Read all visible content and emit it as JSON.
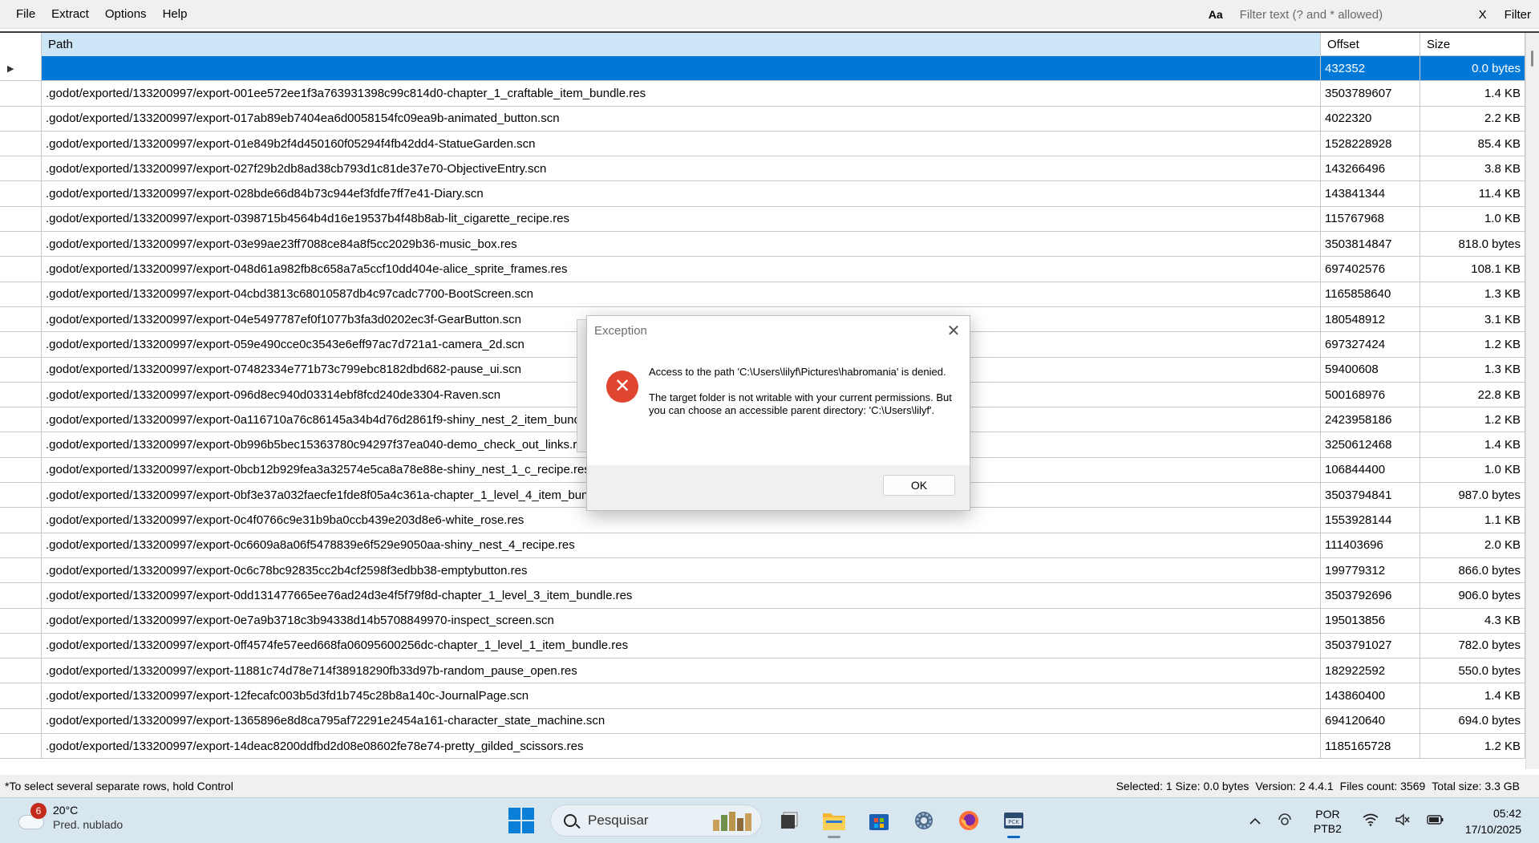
{
  "menu": {
    "items": [
      "File",
      "Extract",
      "Options",
      "Help"
    ],
    "case_toggle": "Aa",
    "filter_placeholder": "Filter text (? and * allowed)",
    "clear_label": "X",
    "filter_button": "Filter"
  },
  "grid": {
    "headers": {
      "path": "Path",
      "offset": "Offset",
      "size": "Size"
    },
    "rows": [
      {
        "path": "",
        "offset": "432352",
        "size": "0.0 bytes",
        "selected": true
      },
      {
        "path": ".godot/exported/133200997/export-001ee572ee1f3a763931398c99c814d0-chapter_1_craftable_item_bundle.res",
        "offset": "3503789607",
        "size": "1.4 KB"
      },
      {
        "path": ".godot/exported/133200997/export-017ab89eb7404ea6d0058154fc09ea9b-animated_button.scn",
        "offset": "4022320",
        "size": "2.2 KB"
      },
      {
        "path": ".godot/exported/133200997/export-01e849b2f4d450160f05294f4fb42dd4-StatueGarden.scn",
        "offset": "1528228928",
        "size": "85.4 KB"
      },
      {
        "path": ".godot/exported/133200997/export-027f29b2db8ad38cb793d1c81de37e70-ObjectiveEntry.scn",
        "offset": "143266496",
        "size": "3.8 KB"
      },
      {
        "path": ".godot/exported/133200997/export-028bde66d84b73c944ef3fdfe7ff7e41-Diary.scn",
        "offset": "143841344",
        "size": "11.4 KB"
      },
      {
        "path": ".godot/exported/133200997/export-0398715b4564b4d16e19537b4f48b8ab-lit_cigarette_recipe.res",
        "offset": "115767968",
        "size": "1.0 KB"
      },
      {
        "path": ".godot/exported/133200997/export-03e99ae23ff7088ce84a8f5cc2029b36-music_box.res",
        "offset": "3503814847",
        "size": "818.0 bytes"
      },
      {
        "path": ".godot/exported/133200997/export-048d61a982fb8c658a7a5ccf10dd404e-alice_sprite_frames.res",
        "offset": "697402576",
        "size": "108.1 KB"
      },
      {
        "path": ".godot/exported/133200997/export-04cbd3813c68010587db4c97cadc7700-BootScreen.scn",
        "offset": "1165858640",
        "size": "1.3 KB"
      },
      {
        "path": ".godot/exported/133200997/export-04e5497787ef0f1077b3fa3d0202ec3f-GearButton.scn",
        "offset": "180548912",
        "size": "3.1 KB"
      },
      {
        "path": ".godot/exported/133200997/export-059e490cce0c3543e6eff97ac7d721a1-camera_2d.scn",
        "offset": "697327424",
        "size": "1.2 KB"
      },
      {
        "path": ".godot/exported/133200997/export-07482334e771b73c799ebc8182dbd682-pause_ui.scn",
        "offset": "59400608",
        "size": "1.3 KB"
      },
      {
        "path": ".godot/exported/133200997/export-096d8ec940d03314ebf8fcd240de3304-Raven.scn",
        "offset": "500168976",
        "size": "22.8 KB"
      },
      {
        "path": ".godot/exported/133200997/export-0a116710a76c86145a34b4d76d2861f9-shiny_nest_2_item_bundle.r",
        "offset": "2423958186",
        "size": "1.2 KB"
      },
      {
        "path": ".godot/exported/133200997/export-0b996b5bec15363780c94297f37ea040-demo_check_out_links.res",
        "offset": "3250612468",
        "size": "1.4 KB"
      },
      {
        "path": ".godot/exported/133200997/export-0bcb12b929fea3a32574e5ca8a78e88e-shiny_nest_1_c_recipe.res",
        "offset": "106844400",
        "size": "1.0 KB"
      },
      {
        "path": ".godot/exported/133200997/export-0bf3e37a032faecfe1fde8f05a4c361a-chapter_1_level_4_item_bundle",
        "offset": "3503794841",
        "size": "987.0 bytes"
      },
      {
        "path": ".godot/exported/133200997/export-0c4f0766c9e31b9ba0ccb439e203d8e6-white_rose.res",
        "offset": "1553928144",
        "size": "1.1 KB"
      },
      {
        "path": ".godot/exported/133200997/export-0c6609a8a06f5478839e6f529e9050aa-shiny_nest_4_recipe.res",
        "offset": "111403696",
        "size": "2.0 KB"
      },
      {
        "path": ".godot/exported/133200997/export-0c6c78bc92835cc2b4cf2598f3edbb38-emptybutton.res",
        "offset": "199779312",
        "size": "866.0 bytes"
      },
      {
        "path": ".godot/exported/133200997/export-0dd131477665ee76ad24d3e4f5f79f8d-chapter_1_level_3_item_bundle.res",
        "offset": "3503792696",
        "size": "906.0 bytes"
      },
      {
        "path": ".godot/exported/133200997/export-0e7a9b3718c3b94338d14b5708849970-inspect_screen.scn",
        "offset": "195013856",
        "size": "4.3 KB"
      },
      {
        "path": ".godot/exported/133200997/export-0ff4574fe57eed668fa06095600256dc-chapter_1_level_1_item_bundle.res",
        "offset": "3503791027",
        "size": "782.0 bytes"
      },
      {
        "path": ".godot/exported/133200997/export-11881c74d78e714f38918290fb33d97b-random_pause_open.res",
        "offset": "182922592",
        "size": "550.0 bytes"
      },
      {
        "path": ".godot/exported/133200997/export-12fecafc003b5d3fd1b745c28b8a140c-JournalPage.scn",
        "offset": "143860400",
        "size": "1.4 KB"
      },
      {
        "path": ".godot/exported/133200997/export-1365896e8d8ca795af72291e2454a161-character_state_machine.scn",
        "offset": "694120640",
        "size": "694.0 bytes"
      },
      {
        "path": ".godot/exported/133200997/export-14deac8200ddfbd2d08e08602fe78e74-pretty_gilded_scissors.res",
        "offset": "1185165728",
        "size": "1.2 KB"
      }
    ]
  },
  "status": {
    "hint": "*To select several separate rows, hold Control",
    "selected": "Selected: 1 Size: 0.0 bytes",
    "version": "Version: 2 4.4.1",
    "files": "Files count: 3569",
    "total": "Total size: 3.3 GB"
  },
  "dialog": {
    "title": "Exception",
    "message": "Access to the path 'C:\\Users\\lilyf\\Pictures\\habromania' is denied.",
    "detail": "The target folder is not writable with your current permissions. But you can choose an accessible parent directory: 'C:\\Users\\lilyf'.",
    "ok_label": "OK"
  },
  "taskbar": {
    "weather_badge": "6",
    "temperature": "20°C",
    "condition": "Pred. nublado",
    "search_label": "Pesquisar",
    "lang_top": "POR",
    "lang_bottom": "PTB2",
    "time": "05:42",
    "date": "17/10/2025"
  },
  "colors": {
    "selection": "#0078d7",
    "header_highlight": "#cce6f8",
    "error_icon": "#e0452f",
    "taskbar": "#d8e6f0"
  }
}
